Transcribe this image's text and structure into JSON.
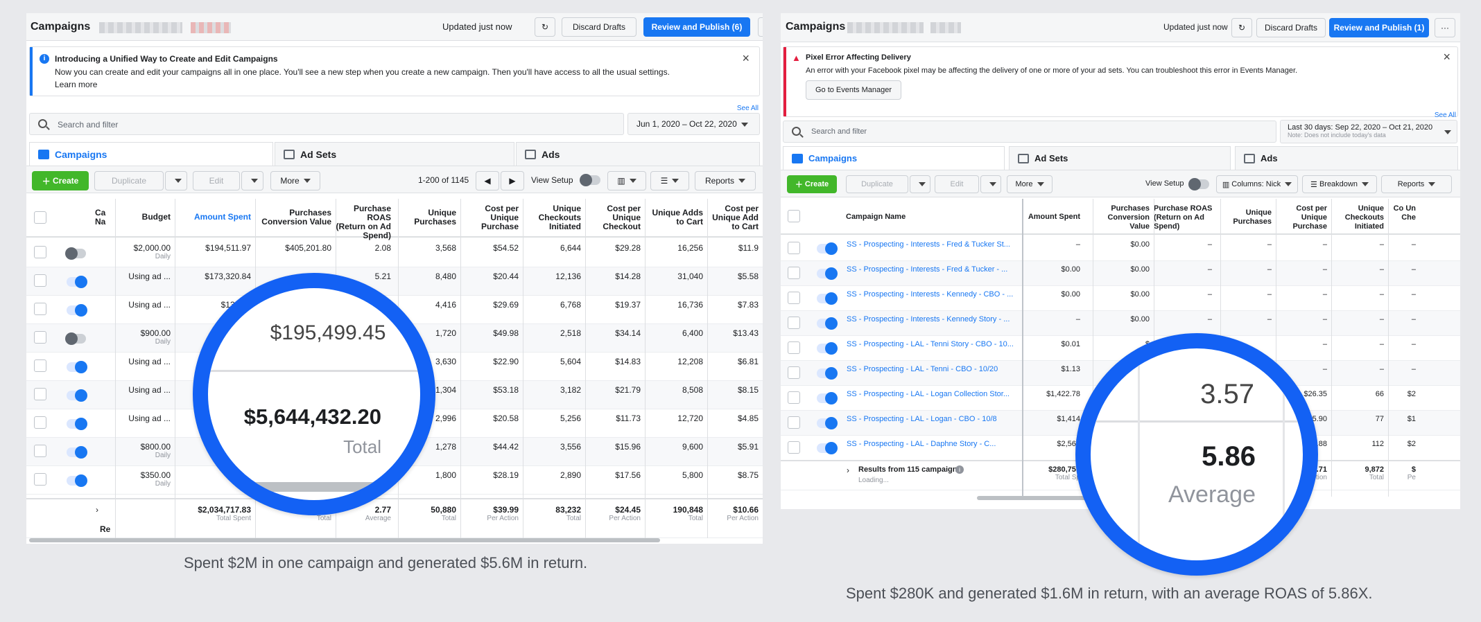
{
  "left": {
    "title": "Campaigns",
    "updated": "Updated just now",
    "discard": "Discard Drafts",
    "publish": "Review and Publish (6)",
    "more_dots": "···",
    "notice": {
      "title": "Introducing a Unified Way to Create and Edit Campaigns",
      "body": "Now you can create and edit your campaigns all in one place. You'll see a new step when you create a new campaign. Then you'll have access to all the usual settings.",
      "link": "Learn more"
    },
    "see_all": "See All",
    "search_placeholder": "Search and filter",
    "date_range": "Jun 1, 2020 – Oct 22, 2020",
    "tabs": [
      "Campaigns",
      "Ad Sets",
      "Ads"
    ],
    "toolbar": {
      "create": "Create",
      "duplicate": "Duplicate",
      "edit": "Edit",
      "more": "More",
      "pagination": "1-200 of 1145",
      "view_setup": "View Setup",
      "reports": "Reports"
    },
    "headers": [
      "Ca Na",
      "Budget",
      "Amount Spent",
      "Purchases Conversion Value",
      "Purchase ROAS (Return on Ad Spend)",
      "Unique Purchases",
      "Cost per Unique Purchase",
      "Unique Checkouts Initiated",
      "Cost per Unique Checkout",
      "Unique Adds to Cart",
      "Cost per Unique Add to Cart"
    ],
    "rows": [
      {
        "on": false,
        "budget": "$2,000.00",
        "budget_sub": "Daily",
        "spent": "$194,511.97",
        "conv": "$405,201.80",
        "roas": "2.08",
        "up": "3,568",
        "cup": "$54.52",
        "uci": "6,644",
        "cuc": "$29.28",
        "uatc": "16,256",
        "cuatc": "$11.9"
      },
      {
        "on": true,
        "budget": "Using ad ...",
        "budget_sub": "",
        "spent": "$173,320.84",
        "conv": "",
        "roas": "5.21",
        "up": "8,480",
        "cup": "$20.44",
        "uci": "12,136",
        "cuc": "$14.28",
        "uatc": "31,040",
        "cuatc": "$5.58"
      },
      {
        "on": true,
        "budget": "Using ad ...",
        "budget_sub": "",
        "spent": "$131,12",
        "conv": "",
        "roas": "",
        "up": "4,416",
        "cup": "$29.69",
        "uci": "6,768",
        "cuc": "$19.37",
        "uatc": "16,736",
        "cuatc": "$7.83"
      },
      {
        "on": false,
        "budget": "$900.00",
        "budget_sub": "Daily",
        "spent": "$",
        "conv": "",
        "roas": "",
        "up": "1,720",
        "cup": "$49.98",
        "uci": "2,518",
        "cuc": "$34.14",
        "uatc": "6,400",
        "cuatc": "$13.43"
      },
      {
        "on": true,
        "budget": "Using ad ...",
        "budget_sub": "",
        "spent": "",
        "conv": "",
        "roas": "",
        "up": "3,630",
        "cup": "$22.90",
        "uci": "5,604",
        "cuc": "$14.83",
        "uatc": "12,208",
        "cuatc": "$6.81"
      },
      {
        "on": true,
        "budget": "Using ad ...",
        "budget_sub": "",
        "spent": "",
        "conv": "",
        "roas": "",
        "up": "1,304",
        "cup": "$53.18",
        "uci": "3,182",
        "cuc": "$21.79",
        "uatc": "8,508",
        "cuatc": "$8.15"
      },
      {
        "on": true,
        "budget": "Using ad ...",
        "budget_sub": "",
        "spent": "",
        "conv": "",
        "roas": "",
        "up": "2,996",
        "cup": "$20.58",
        "uci": "5,256",
        "cuc": "$11.73",
        "uatc": "12,720",
        "cuatc": "$4.85"
      },
      {
        "on": true,
        "budget": "$800.00",
        "budget_sub": "Daily",
        "spent": "",
        "conv": "",
        "roas": "",
        "up": "1,278",
        "cup": "$44.42",
        "uci": "3,556",
        "cuc": "$15.96",
        "uatc": "9,600",
        "cuatc": "$5.91"
      },
      {
        "on": true,
        "budget": "$350.00",
        "budget_sub": "Daily",
        "spent": "$50,",
        "conv": "",
        "roas": "",
        "up": "1,800",
        "cup": "$28.19",
        "uci": "2,890",
        "cuc": "$17.56",
        "uatc": "5,800",
        "cuatc": "$8.75"
      }
    ],
    "totals": {
      "spent": "$2,034,717.83",
      "spent_sub": "Total Spent",
      "conv_sub": "Total",
      "roas": "2.77",
      "roas_sub": "Average",
      "up": "50,880",
      "up_sub": "Total",
      "cup": "$39.99",
      "cup_sub": "Per Action",
      "uci": "83,232",
      "uci_sub": "Total",
      "cuc": "$24.45",
      "cuc_sub": "Per Action",
      "uatc": "190,848",
      "uatc_sub": "Total",
      "cuatc": "$10.66",
      "cuatc_sub": "Per Action",
      "re": "Re"
    },
    "magnifier": {
      "top": "$195,499.45",
      "main": "$5,644,432.20",
      "label": "Total"
    },
    "caption": "Spent $2M in one campaign and generated $5.6M in return."
  },
  "right": {
    "title": "Campaigns",
    "updated": "Updated just now",
    "discard": "Discard Drafts",
    "publish": "Review and Publish (1)",
    "more_dots": "···",
    "notice": {
      "title": "Pixel Error Affecting Delivery",
      "body": "An error with your Facebook pixel may be affecting the delivery of one or more of your ad sets. You can troubleshoot this error in Events Manager.",
      "button": "Go to Events Manager"
    },
    "see_all": "See All",
    "search_placeholder": "Search and filter",
    "date_range": "Last 30 days: Sep 22, 2020 – Oct 21, 2020",
    "date_note": "Note: Does not include today's data",
    "tabs": [
      "Campaigns",
      "Ad Sets",
      "Ads"
    ],
    "toolbar": {
      "create": "Create",
      "duplicate": "Duplicate",
      "edit": "Edit",
      "more": "More",
      "view_setup": "View Setup",
      "columns": "Columns: Nick",
      "breakdown": "Breakdown",
      "reports": "Reports"
    },
    "headers": [
      "Campaign Name",
      "Amount Spent",
      "Purchases Conversion Value",
      "Purchase ROAS (Return on Ad Spend)",
      "Unique Purchases",
      "Cost per Unique Purchase",
      "Unique Checkouts Initiated",
      "Co Un Che"
    ],
    "rows": [
      {
        "name": "SS - Prospecting - Interests - Fred & Tucker St...",
        "spent": "–",
        "conv": "$0.00",
        "roas": "–",
        "up": "–",
        "cup": "–",
        "uci": "–",
        "last": "–"
      },
      {
        "name": "SS - Prospecting - Interests - Fred & Tucker - ...",
        "spent": "$0.00",
        "conv": "$0.00",
        "roas": "–",
        "up": "–",
        "cup": "–",
        "uci": "–",
        "last": "–"
      },
      {
        "name": "SS - Prospecting - Interests - Kennedy - CBO - ...",
        "spent": "$0.00",
        "conv": "$0.00",
        "roas": "–",
        "up": "–",
        "cup": "–",
        "uci": "–",
        "last": "–"
      },
      {
        "name": "SS - Prospecting - Interests - Kennedy Story - ...",
        "spent": "–",
        "conv": "$0.00",
        "roas": "–",
        "up": "–",
        "cup": "–",
        "uci": "–",
        "last": "–"
      },
      {
        "name": "SS - Prospecting - LAL - Tenni Story - CBO - 10...",
        "spent": "$0.01",
        "conv": "$",
        "roas": "",
        "up": "",
        "cup": "–",
        "uci": "–",
        "last": "–"
      },
      {
        "name": "SS - Prospecting - LAL - Tenni - CBO - 10/20",
        "spent": "$1.13",
        "conv": "",
        "roas": "",
        "up": "",
        "cup": "–",
        "uci": "–",
        "last": "–"
      },
      {
        "name": "SS - Prospecting - LAL - Logan Collection Stor...",
        "spent": "$1,422.78",
        "conv": "",
        "roas": "",
        "up": "",
        "cup": "$26.35",
        "uci": "66",
        "last": "$2"
      },
      {
        "name": "SS - Prospecting - LAL - Logan - CBO - 10/8",
        "spent": "$1,414",
        "conv": "",
        "roas": "",
        "up": "",
        "cup": "$15.90",
        "uci": "77",
        "last": "$1"
      },
      {
        "name": "SS - Prospecting - LAL - Daphne Story - C...",
        "spent": "$2,562",
        "conv": "",
        "roas": "",
        "up": "",
        "cup": "$22.88",
        "uci": "112",
        "last": "$2"
      }
    ],
    "totals": {
      "label": "Results from 115 campaigns",
      "loading": "Loading...",
      "spent": "$280,757",
      "spent_sub": "Total Sp",
      "cup": "$27.71",
      "cup_sub": "Per Action",
      "uci": "9,872",
      "uci_sub": "Total",
      "last": "$",
      "last_sub": "Pe"
    },
    "magnifier": {
      "top": "3.57",
      "main": "5.86",
      "label": "Average"
    },
    "caption": "Spent $280K and generated $1.6M in return, with an average ROAS of 5.86X."
  },
  "colors": {
    "accent": "#1877f2",
    "magnifier": "#1361f4",
    "green": "#42b72a",
    "error": "#e41e3f"
  }
}
